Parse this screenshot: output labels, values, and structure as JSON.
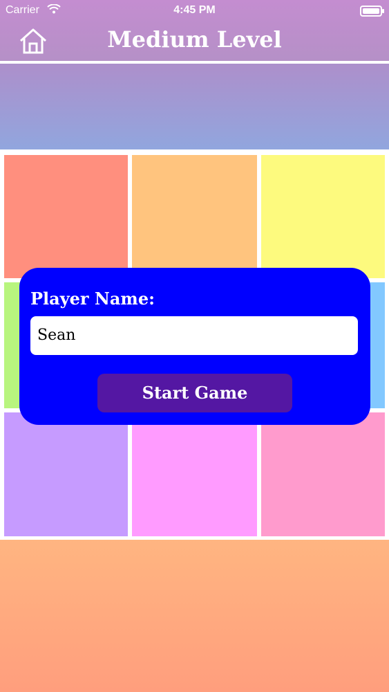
{
  "status_bar": {
    "carrier": "Carrier",
    "time": "4:45 PM"
  },
  "header": {
    "title": "Medium Level",
    "home_icon": "home-icon"
  },
  "grid": {
    "colors": [
      "#ff8f7e",
      "#ffc47e",
      "#fdfa7e",
      "#b8f57e",
      "#ffffff",
      "#82c8ff",
      "#c69bff",
      "#ff9bff",
      "#ff9bcd"
    ]
  },
  "dialog": {
    "label": "Player Name:",
    "input_value": "Sean",
    "start_label": "Start Game",
    "bg_color": "#0000ff",
    "button_color": "#5417a3"
  }
}
